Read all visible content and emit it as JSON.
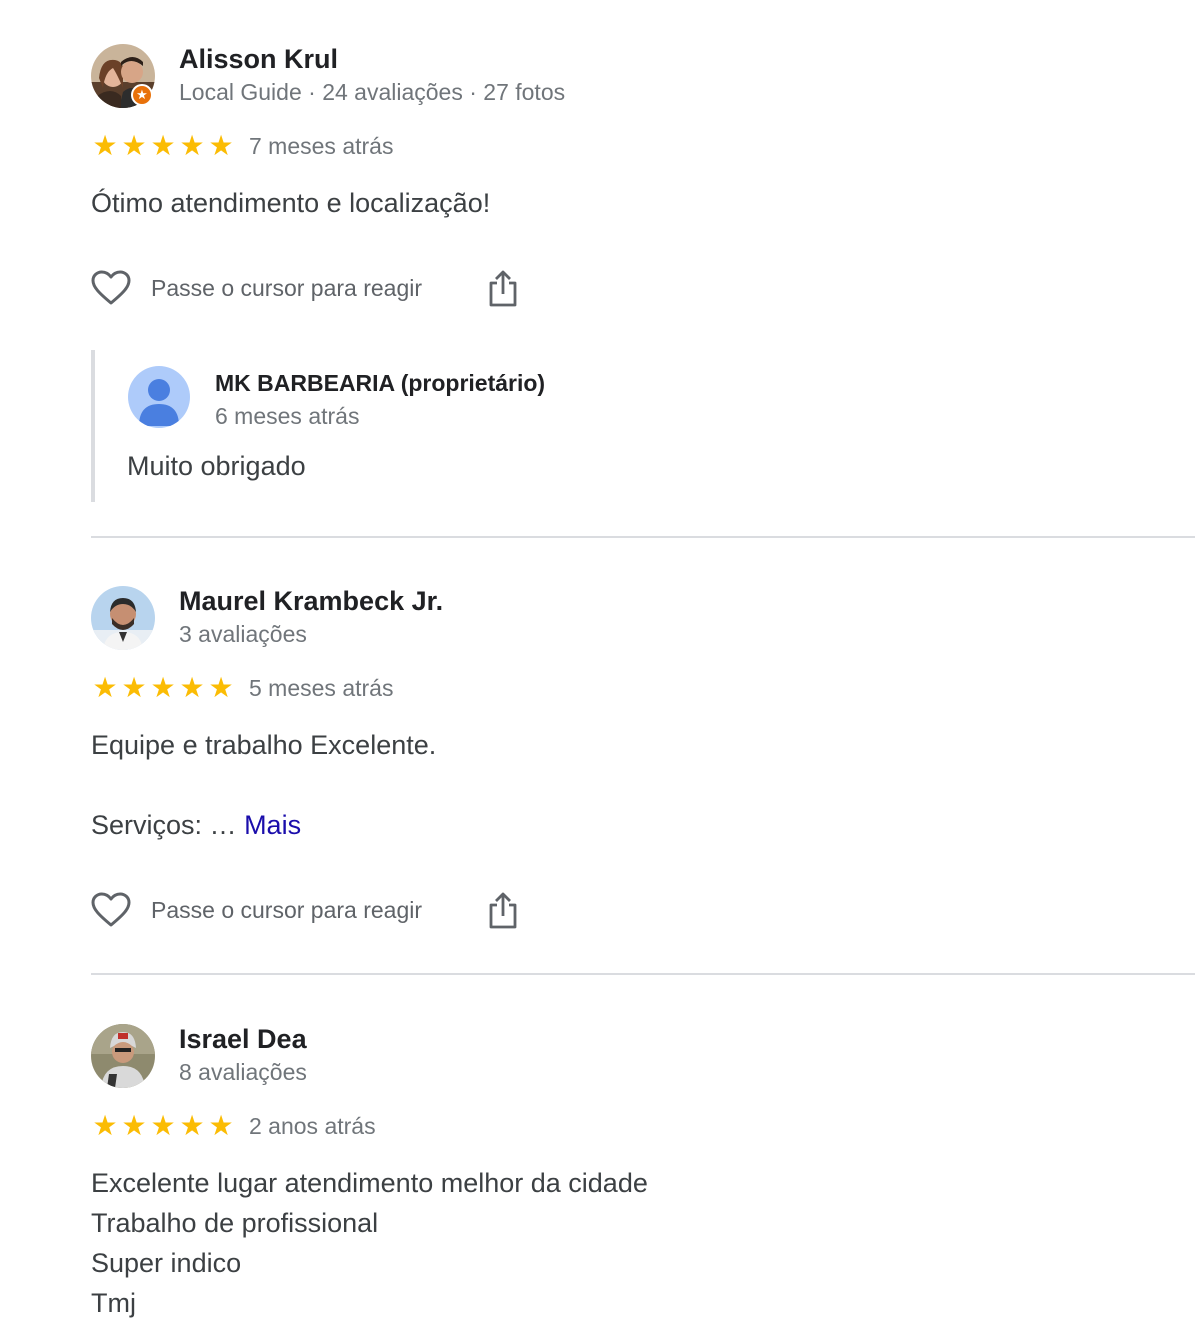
{
  "reviews": [
    {
      "reviewer_name": "Alisson Krul",
      "reviewer_meta": "Local Guide · 24 avaliações · 27 fotos",
      "local_guide_badge_icon": "star-icon",
      "rating": 5,
      "time": "7 meses atrás",
      "text_lines": [
        "Ótimo atendimento e localização!"
      ],
      "react_label": "Passe o cursor para reagir",
      "owner_reply": {
        "name": "MK BARBEARIA (proprietário)",
        "time": "6 meses atrás",
        "text": "Muito obrigado"
      }
    },
    {
      "reviewer_name": "Maurel Krambeck Jr.",
      "reviewer_meta": "3 avaliações",
      "rating": 5,
      "time": "5 meses atrás",
      "text_lines": [
        "Equipe e trabalho Excelente."
      ],
      "services_label": "Serviços: …",
      "more_label": "Mais",
      "react_label": "Passe o cursor para reagir"
    },
    {
      "reviewer_name": "Israel Dea",
      "reviewer_meta": "8 avaliações",
      "rating": 5,
      "time": "2 anos atrás",
      "text_lines": [
        "Excelente lugar atendimento melhor da cidade",
        "Trabalho de profissional",
        "Super indico",
        "Tmj"
      ]
    }
  ],
  "icons": {
    "star": "★",
    "heart": "heart-icon",
    "share": "share-icon"
  },
  "colors": {
    "star": "#fbbc04",
    "link": "#1a0dab",
    "badge": "#e8710a",
    "owner_avatar_bg": "#aecbfa",
    "owner_avatar_fg": "#4a7fe0"
  }
}
